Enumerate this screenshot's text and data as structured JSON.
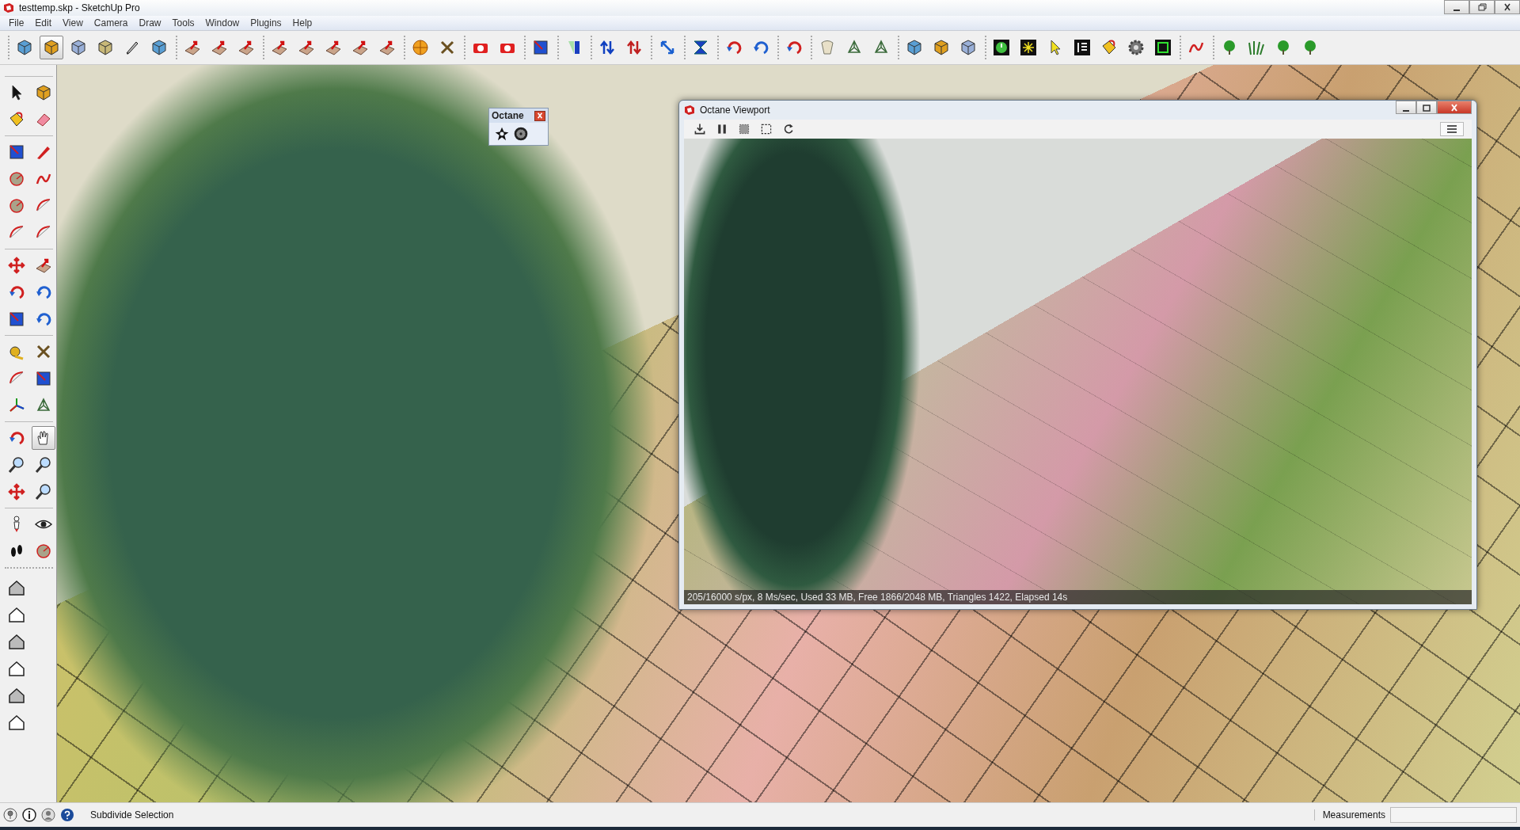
{
  "window": {
    "title": "testtemp.skp - SketchUp Pro"
  },
  "menu": [
    "File",
    "Edit",
    "View",
    "Camera",
    "Draw",
    "Tools",
    "Window",
    "Plugins",
    "Help"
  ],
  "main_toolbar": [
    {
      "selected": false
    },
    {
      "selected": true
    },
    {
      "selected": false
    },
    {
      "selected": false
    },
    {
      "selected": false
    },
    {
      "selected": false
    },
    {
      "selected": false
    },
    {
      "selected": false
    },
    {
      "selected": false
    },
    {
      "selected": false
    },
    {
      "selected": false
    },
    {
      "selected": false
    },
    {
      "selected": false
    },
    {
      "selected": false
    },
    {
      "selected": false
    },
    {
      "selected": false
    },
    {
      "selected": false
    },
    {
      "selected": false
    },
    {
      "selected": false
    },
    {
      "selected": false
    },
    {
      "selected": false
    },
    {
      "selected": false
    },
    {
      "selected": false
    },
    {
      "selected": false
    },
    {
      "selected": false
    },
    {
      "selected": false
    },
    {
      "selected": false
    },
    {
      "selected": false
    },
    {
      "selected": false
    },
    {
      "selected": false
    },
    {
      "selected": false
    },
    {
      "selected": false
    },
    {
      "selected": false
    },
    {
      "selected": false
    },
    {
      "selected": false
    },
    {
      "selected": false
    },
    {
      "selected": false
    },
    {
      "selected": false
    },
    {
      "selected": false
    },
    {
      "selected": false
    },
    {
      "selected": false
    },
    {
      "selected": false
    },
    {
      "selected": false
    },
    {
      "selected": false
    },
    {
      "selected": false
    }
  ],
  "tool_palette": [
    {
      "selected": false
    },
    {
      "selected": false
    },
    {
      "selected": false
    },
    {
      "selected": false
    },
    {
      "selected": false
    },
    {
      "selected": false
    },
    {
      "selected": false
    },
    {
      "selected": false
    },
    {
      "selected": false
    },
    {
      "selected": false
    },
    {
      "selected": false
    },
    {
      "selected": false
    },
    {
      "selected": false
    },
    {
      "selected": false
    },
    {
      "selected": false
    },
    {
      "selected": false
    },
    {
      "selected": false
    },
    {
      "selected": false
    },
    {
      "selected": false
    },
    {
      "selected": false
    },
    {
      "selected": false
    },
    {
      "selected": false
    },
    {
      "selected": false
    },
    {
      "selected": false
    },
    {
      "selected": false
    },
    {
      "selected": true
    },
    {
      "selected": false
    },
    {
      "selected": false
    },
    {
      "selected": false
    },
    {
      "selected": false
    },
    {
      "selected": false
    },
    {
      "selected": false
    },
    {
      "selected": false
    },
    {
      "selected": false
    },
    {
      "selected": false
    },
    {
      "selected": false
    },
    {
      "selected": false
    },
    {
      "selected": false
    },
    {
      "selected": false
    },
    {
      "selected": false
    }
  ],
  "octane_palette": {
    "title": "Octane"
  },
  "octane_viewport": {
    "title": "Octane Viewport",
    "status": "205/16000 s/px, 8 Ms/sec, Used 33 MB, Free 1866/2048 MB, Triangles 1422, Elapsed 14s"
  },
  "status_bar": {
    "hint": "Subdivide Selection",
    "measurements_label": "Measurements"
  }
}
